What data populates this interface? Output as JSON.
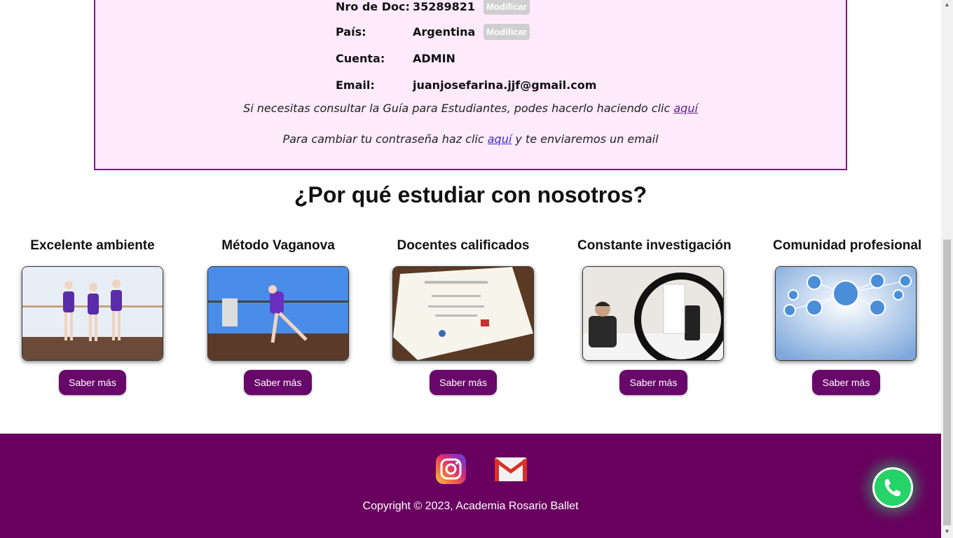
{
  "profile": {
    "rows": [
      {
        "label": "Nro de Doc:",
        "value": "35289821",
        "button": "Modificar"
      },
      {
        "label": "País:",
        "value": "Argentina",
        "button": "Modificar"
      },
      {
        "label": "Cuenta:",
        "value": "ADMIN"
      },
      {
        "label": "Email:",
        "value": "juanjosefarina.jjf@gmail.com"
      }
    ],
    "guide_text": "Si necesitas consultar la Guía para Estudiantes, podes hacerlo haciendo clic",
    "guide_link": "aquí",
    "password_text_before": "Para cambiar tu contraseña haz clic",
    "password_link": "aquí",
    "password_text_after": "y te enviaremos un email"
  },
  "section_title": "¿Por qué estudiar con nosotros?",
  "cards": [
    {
      "title": "Excelente ambiente",
      "button": "Saber más"
    },
    {
      "title": "Método Vaganova",
      "button": "Saber más"
    },
    {
      "title": "Docentes calificados",
      "button": "Saber más"
    },
    {
      "title": "Constante investigación",
      "button": "Saber más"
    },
    {
      "title": "Comunidad profesional",
      "button": "Saber más"
    }
  ],
  "footer": {
    "copyright": "Copyright © 2023, Academia Rosario Ballet",
    "icons": [
      "instagram-icon",
      "gmail-icon"
    ]
  },
  "floating": {
    "icon": "whatsapp-icon"
  },
  "colors": {
    "brand_purple": "#68086a",
    "profile_bg": "#fdeafd",
    "whatsapp_green": "#25d366"
  }
}
